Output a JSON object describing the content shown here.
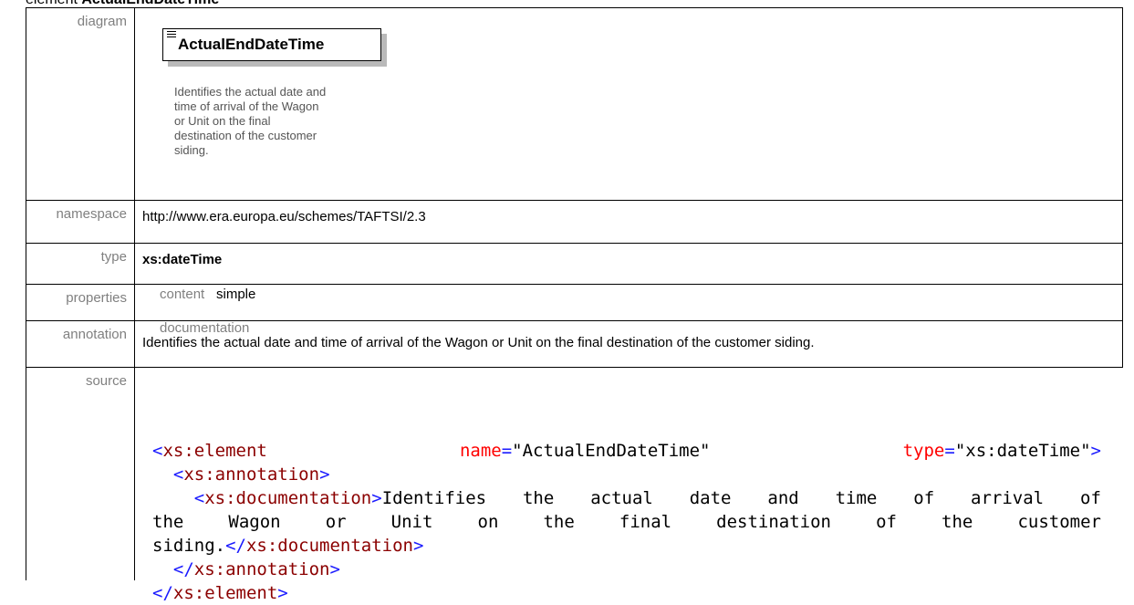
{
  "header": {
    "prefix": "element",
    "name": "ActualEndDateTime"
  },
  "rows": {
    "diagram_label": "diagram",
    "namespace_label": "namespace",
    "type_label": "type",
    "properties_label": "properties",
    "annotation_label": "annotation",
    "source_label": "source"
  },
  "diagram": {
    "element_name": "ActualEndDateTime",
    "documentation_lines": [
      "Identifies the actual date and",
      "time of arrival of the Wagon",
      "or Unit on the final",
      "destination of the customer",
      "siding."
    ]
  },
  "namespace": "http://www.era.europa.eu/schemes/TAFTSI/2.3",
  "type": "xs:dateTime",
  "properties": {
    "key": "content",
    "value": "simple"
  },
  "annotation": {
    "key": "documentation",
    "text": "Identifies the actual date and time of arrival of the Wagon or Unit on the final destination of the customer siding."
  },
  "source": {
    "element_open": "xs:element",
    "attr_name": "name",
    "attr_name_value": "\"ActualEndDateTime\"",
    "attr_type": "type",
    "attr_type_value": "\"xs:dateTime\"",
    "annotation_tag": "xs:annotation",
    "documentation_tag": "xs:documentation",
    "doc_words_line1": [
      "Identifies",
      "the",
      "actual",
      "date",
      "and",
      "time",
      "of",
      "arrival",
      "of"
    ],
    "doc_words_line2": [
      "the",
      "Wagon",
      "or",
      "Unit",
      "on",
      "the",
      "final",
      "destination",
      "of",
      "the",
      "customer"
    ],
    "doc_end": "siding."
  },
  "colors": {
    "label_gray": "#808080",
    "tag": "#8b0000",
    "punct": "#1a1aff",
    "attr": "#ff0000"
  }
}
